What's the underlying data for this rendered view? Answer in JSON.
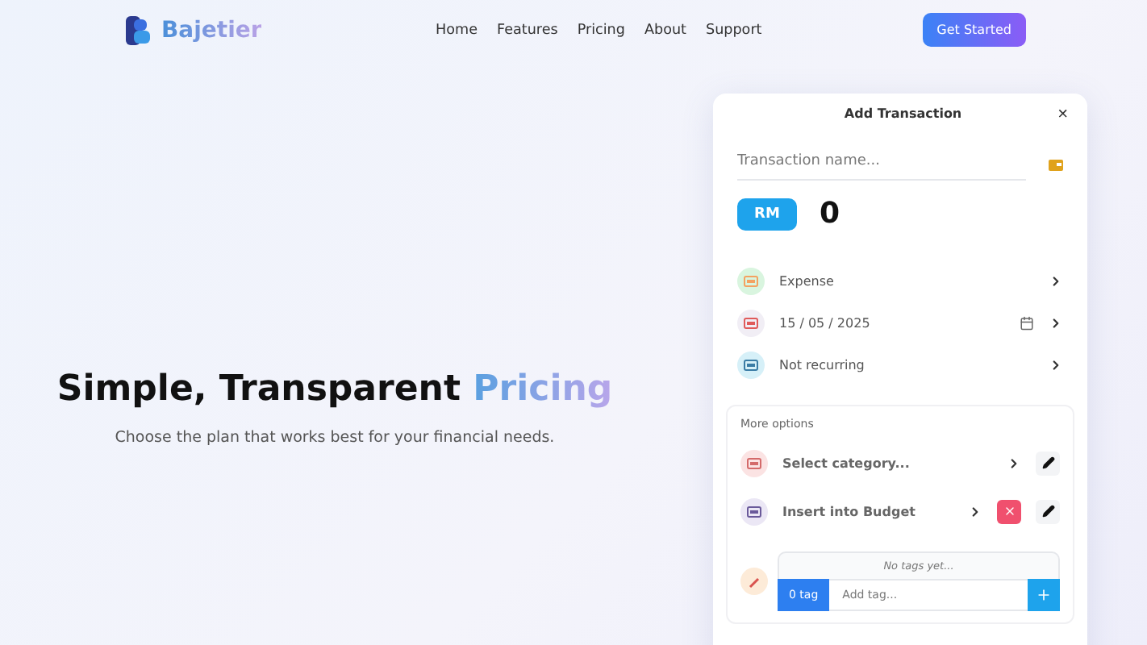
{
  "brand": {
    "name": "Bajetier"
  },
  "nav": [
    "Home",
    "Features",
    "Pricing",
    "About",
    "Support"
  ],
  "cta": "Get Started",
  "hero": {
    "title": "Simple, Transparent",
    "highlight": "Pricing",
    "subtitle": "Choose the plan that works best for your financial needs."
  },
  "dialog": {
    "title": "Add Transaction",
    "close": "×",
    "name_field": {
      "placeholder": "Transaction name..."
    },
    "currency": "RM",
    "amount": "0",
    "rows": [
      {
        "kind": "type",
        "label": "Expense",
        "color": "#d9f5df"
      },
      {
        "kind": "date",
        "label": "15 / 05 / 2025",
        "color": "#f1eef5"
      },
      {
        "kind": "repeat",
        "label": "Not recurring",
        "color": "#d6f0f8"
      }
    ],
    "more": {
      "title": "More options",
      "rows": [
        {
          "kind": "category",
          "label": "Select category...",
          "color": "#fbe3e3",
          "removable": false
        },
        {
          "kind": "budget",
          "label": "Insert into Budget",
          "color": "#ebe7f5",
          "removable": true
        }
      ]
    },
    "tags": {
      "empty": "No tags yet...",
      "count": "0 tag",
      "placeholder": "Add tag..."
    }
  }
}
